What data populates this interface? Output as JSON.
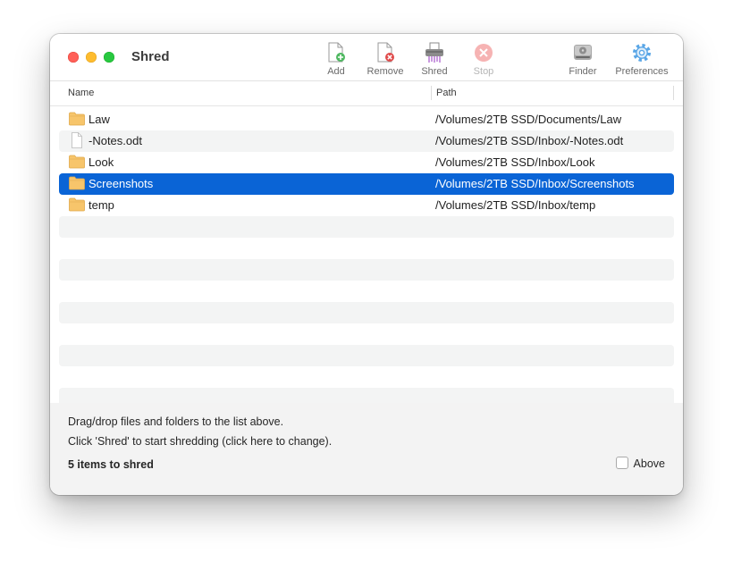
{
  "window": {
    "title": "Shred"
  },
  "toolbar": {
    "add": "Add",
    "remove": "Remove",
    "shred": "Shred",
    "stop": "Stop",
    "finder": "Finder",
    "preferences": "Preferences"
  },
  "columns": {
    "name": "Name",
    "path": "Path"
  },
  "rows": [
    {
      "name": "Law",
      "path": "/Volumes/2TB SSD/Documents/Law",
      "icon": "folder-icon"
    },
    {
      "name": "-Notes.odt",
      "path": "/Volumes/2TB SSD/Inbox/-Notes.odt",
      "icon": "document-icon"
    },
    {
      "name": "Look",
      "path": "/Volumes/2TB SSD/Inbox/Look",
      "icon": "folder-icon"
    },
    {
      "name": "Screenshots",
      "path": "/Volumes/2TB SSD/Inbox/Screenshots",
      "icon": "folder-icon",
      "selected": true
    },
    {
      "name": "temp",
      "path": "/Volumes/2TB SSD/Inbox/temp",
      "icon": "folder-icon"
    }
  ],
  "footer": {
    "hint1": "Drag/drop files and folders to the list above.",
    "hint2": "Click 'Shred' to start shredding (click here to change).",
    "count": "5 items to shred",
    "above_label": "Above",
    "above_checked": false
  },
  "colors": {
    "selection": "#0a64d6",
    "folder": "#f7c56b",
    "add_badge": "#4fb861",
    "remove_badge": "#e04b4b",
    "finder_blue": "#5aa6e6"
  }
}
